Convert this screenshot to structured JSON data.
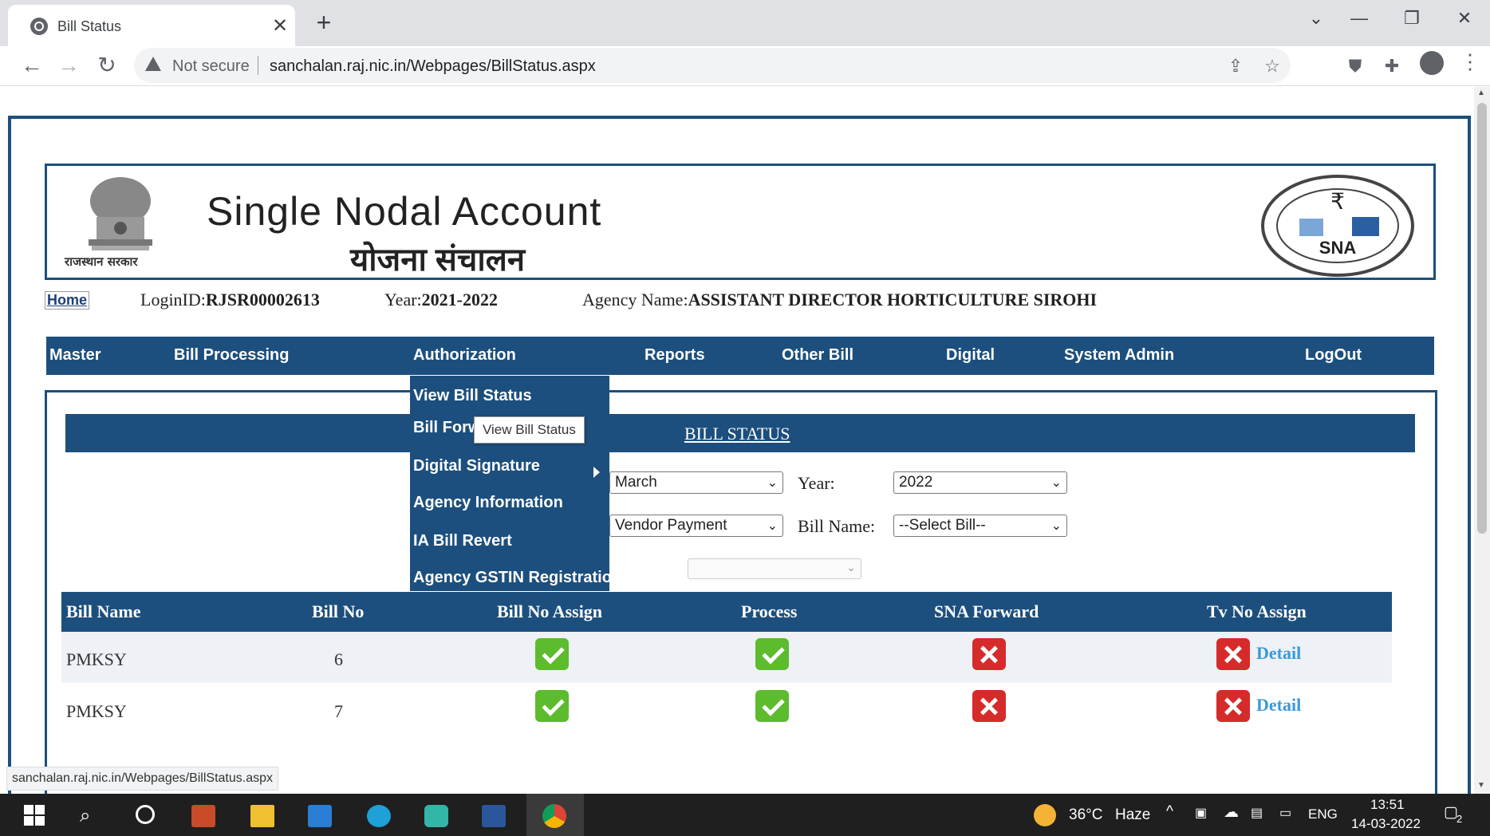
{
  "browser": {
    "tab_title": "Bill Status",
    "tab_close": "✕",
    "new_tab": "+",
    "security_label": "Not secure",
    "url": "sanchalan.raj.nic.in/Webpages/BillStatus.aspx",
    "window_controls": [
      "⌄",
      "—",
      "❐",
      "✕"
    ],
    "status_url": "sanchalan.raj.nic.in/Webpages/BillStatus.aspx"
  },
  "header": {
    "title": "Single Nodal Account",
    "subtitle": "योजना संचालन",
    "emblem_caption": "राजस्थान सरकार",
    "logo_text": "SNA"
  },
  "infobar": {
    "home": "Home",
    "login_label": "LoginID:",
    "login_value": "RJSR00002613",
    "year_label": "Year:",
    "year_value": "2021-2022",
    "agency_label": "Agency Name:",
    "agency_value": "ASSISTANT DIRECTOR HORTICULTURE SIROHI"
  },
  "nav": {
    "items": [
      "Master",
      "Bill Processing",
      "Authorization",
      "Reports",
      "Other Bill",
      "Digital",
      "System Admin",
      "LogOut"
    ]
  },
  "dropdown": {
    "items": [
      "View Bill Status",
      "Bill Forw",
      "Digital Signature",
      "Agency Information",
      "IA Bill Revert",
      "Agency GSTIN Registration"
    ],
    "tooltip": "View Bill Status"
  },
  "status": {
    "title": "BILL STATUS",
    "month_value": "March",
    "year_label": "Year:",
    "year_value": "2022",
    "type_value": "Vendor Payment",
    "bill_name_label": "Bill Name:",
    "bill_name_value": "--Select Bill--"
  },
  "table": {
    "columns": [
      "Bill Name",
      "Bill No",
      "Bill No Assign",
      "Process",
      "SNA Forward",
      "Tv No Assign"
    ],
    "rows": [
      {
        "bill_name": "PMKSY",
        "bill_no": "6",
        "bill_no_assign": true,
        "process": true,
        "sna_forward": false,
        "tv_no_assign": false,
        "link": "Detail"
      },
      {
        "bill_name": "PMKSY",
        "bill_no": "7",
        "bill_no_assign": true,
        "process": true,
        "sna_forward": false,
        "tv_no_assign": false,
        "link": "Detail"
      }
    ]
  },
  "taskbar": {
    "temperature": "36°C",
    "weather": "Haze",
    "language": "ENG",
    "time": "13:51",
    "date": "14-03-2022",
    "notification_count": "2"
  },
  "colors": {
    "primary": "#1c4f7d",
    "check": "#5dbb2e",
    "cross": "#d62b2b",
    "link": "#3a9ad9"
  }
}
